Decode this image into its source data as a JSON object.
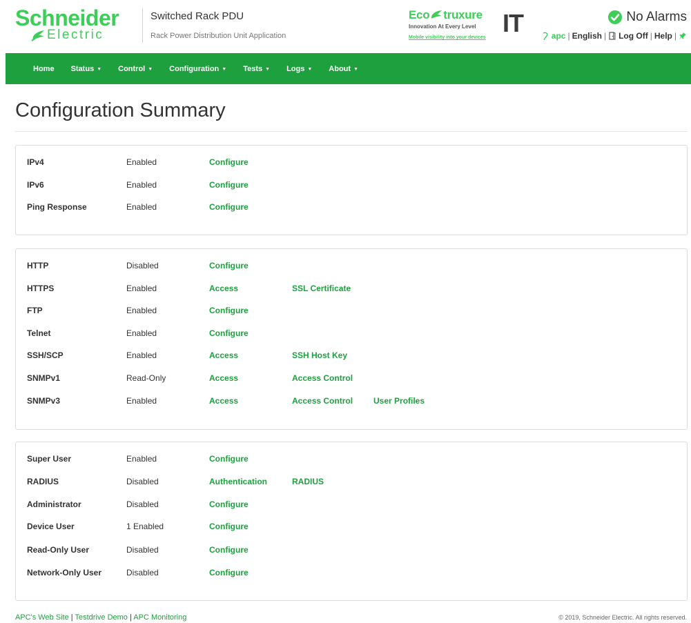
{
  "brand": {
    "company_top": "Schneider",
    "company_bottom": "Electric",
    "product_name": "Switched Rack PDU",
    "subtitle": "Rack Power Distribution Unit Application",
    "color": "#3dcd58"
  },
  "eco": {
    "brand_prefix": "Eco",
    "brand_suffix": "truxure",
    "tagline": "Innovation At Every Level",
    "link": "Mobile visibility into your devices",
    "it": "IT"
  },
  "alarm": {
    "text": "No Alarms",
    "icon": "check-circle-icon"
  },
  "util": {
    "user": "apc",
    "language": "English",
    "logoff": "Log Off",
    "help": "Help"
  },
  "nav": {
    "home": "Home",
    "status": "Status",
    "control": "Control",
    "configuration": "Configuration",
    "tests": "Tests",
    "logs": "Logs",
    "about": "About",
    "color": "#1fa03f"
  },
  "page_title": "Configuration Summary",
  "network": [
    {
      "label": "IPv4",
      "status": "Enabled",
      "links": [
        "Configure"
      ]
    },
    {
      "label": "IPv6",
      "status": "Enabled",
      "links": [
        "Configure"
      ]
    },
    {
      "label": "Ping Response",
      "status": "Enabled",
      "links": [
        "Configure"
      ]
    }
  ],
  "protocols": [
    {
      "label": "HTTP",
      "status": "Disabled",
      "links": [
        "Configure"
      ]
    },
    {
      "label": "HTTPS",
      "status": "Enabled",
      "links": [
        "Access",
        "SSL Certificate"
      ]
    },
    {
      "label": "FTP",
      "status": "Enabled",
      "links": [
        "Configure"
      ]
    },
    {
      "label": "Telnet",
      "status": "Enabled",
      "links": [
        "Configure"
      ]
    },
    {
      "label": "SSH/SCP",
      "status": "Enabled",
      "links": [
        "Access",
        "SSH Host Key"
      ]
    },
    {
      "label": "SNMPv1",
      "status": "Read-Only",
      "links": [
        "Access",
        "Access Control"
      ]
    },
    {
      "label": "SNMPv3",
      "status": "Enabled",
      "links": [
        "Access",
        "Access Control",
        "User Profiles"
      ]
    }
  ],
  "users": [
    {
      "label": "Super User",
      "status": "Enabled",
      "links": [
        "Configure"
      ]
    },
    {
      "label": "RADIUS",
      "status": "Disabled",
      "links": [
        "Authentication",
        "RADIUS"
      ]
    },
    {
      "label": "Administrator",
      "status": "Disabled",
      "links": [
        "Configure"
      ]
    },
    {
      "label": "Device User",
      "status": "1 Enabled",
      "links": [
        "Configure"
      ]
    },
    {
      "label": "Read-Only User",
      "status": "Disabled",
      "links": [
        "Configure"
      ]
    },
    {
      "label": "Network-Only User",
      "status": "Disabled",
      "links": [
        "Configure"
      ]
    }
  ],
  "footer": {
    "link1": "APC's Web Site",
    "link2": "Testdrive Demo",
    "link3": "APC Monitoring",
    "copyright": "© 2019, Schneider Electric. All rights reserved."
  }
}
